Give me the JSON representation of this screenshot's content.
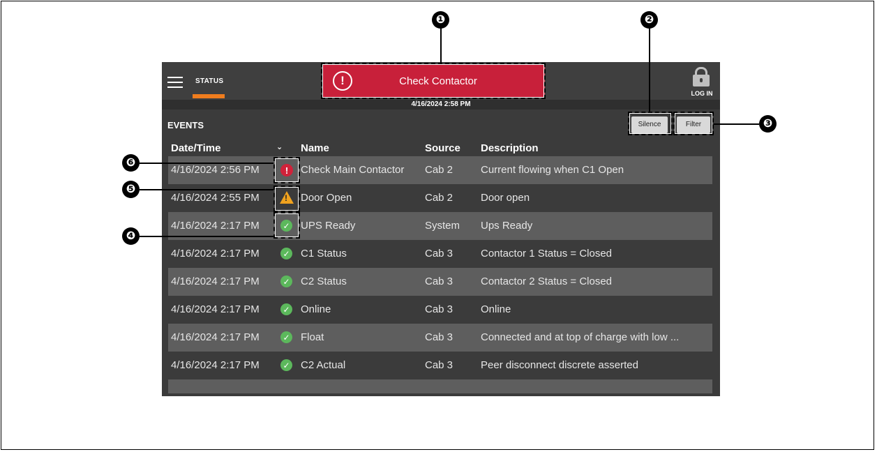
{
  "header": {
    "nav_label": "STATUS",
    "alarm_text": "Check Contactor",
    "login_label": "LOG IN",
    "timestamp": "4/16/2024 2:58 PM"
  },
  "events": {
    "title": "EVENTS",
    "silence_label": "Silence",
    "filter_label": "Filter",
    "columns": {
      "datetime": "Date/Time",
      "name": "Name",
      "source": "Source",
      "description": "Description"
    },
    "rows": [
      {
        "datetime": "4/16/2024 2:56 PM",
        "name": "Check Main Contactor",
        "source": "Cab 2",
        "description": "Current flowing when C1 Open",
        "icon": "error-icon"
      },
      {
        "datetime": "4/16/2024 2:55 PM",
        "name": "Door Open",
        "source": "Cab 2",
        "description": "Door open",
        "icon": "warning-icon"
      },
      {
        "datetime": "4/16/2024 2:17 PM",
        "name": "UPS Ready",
        "source": "System",
        "description": "Ups Ready",
        "icon": "check-icon"
      },
      {
        "datetime": "4/16/2024 2:17 PM",
        "name": "C1 Status",
        "source": "Cab 3",
        "description": "Contactor 1 Status = Closed",
        "icon": "check-icon"
      },
      {
        "datetime": "4/16/2024 2:17 PM",
        "name": "C2 Status",
        "source": "Cab 3",
        "description": "Contactor 2 Status = Closed",
        "icon": "check-icon"
      },
      {
        "datetime": "4/16/2024 2:17 PM",
        "name": "Online",
        "source": "Cab 3",
        "description": "Online",
        "icon": "check-icon"
      },
      {
        "datetime": "4/16/2024 2:17 PM",
        "name": "Float",
        "source": "Cab 3",
        "description": "Connected and at top of charge with low ...",
        "icon": "check-icon"
      },
      {
        "datetime": "4/16/2024 2:17 PM",
        "name": "C2 Actual",
        "source": "Cab 3",
        "description": "Peer disconnect discrete asserted",
        "icon": "check-icon"
      }
    ]
  },
  "callouts": [
    "❶",
    "❷",
    "❸",
    "❹",
    "❺",
    "❻"
  ],
  "colors": {
    "alarm": "#c8203a",
    "accent": "#f07d1e",
    "ok": "#5cb85c",
    "warning": "#f0a21e"
  }
}
